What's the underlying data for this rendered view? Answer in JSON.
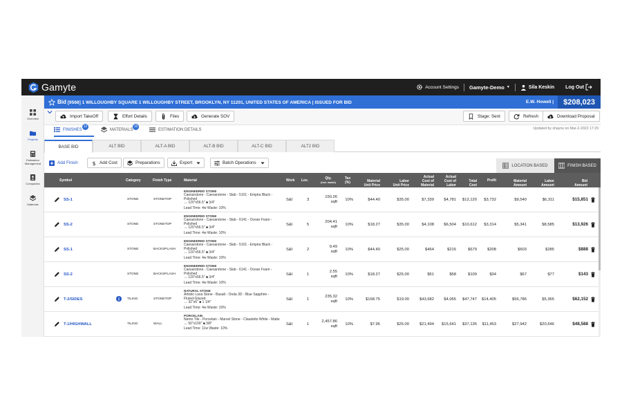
{
  "app": {
    "name": "Gamyte",
    "account_settings": "Account Settings",
    "org": "Gamyte-Demo",
    "user": "Sila Keskin",
    "logout": "Log Out"
  },
  "sidebar": {
    "items": [
      {
        "label": "Overview",
        "icon": "grid-icon"
      },
      {
        "label": "Projects",
        "icon": "folder-icon"
      },
      {
        "label": "Estimation Management",
        "icon": "calculator-icon"
      },
      {
        "label": "Companies",
        "icon": "contact-card-icon"
      },
      {
        "label": "Materials",
        "icon": "layers-icon"
      }
    ]
  },
  "bid": {
    "prefix": "Bid",
    "title": "[9568] 1 WILLOUGHBY SQUARE 1 WILLOUGHBY STREET, BROOKLYN, NY 11201, UNITED STATES OF AMERICA | ISSUED FOR BID",
    "client": "E.W. Howell |",
    "amount": "$208,023"
  },
  "toolbar": {
    "import": "Import TakeOff",
    "effort": "Effort Details",
    "files": "Files",
    "sov": "Generate SOV",
    "stage": "Stage: Sent",
    "refresh": "Refresh",
    "download": "Download Proposal"
  },
  "project_tabs": [
    {
      "label": "FINISHES",
      "badge": "12"
    },
    {
      "label": "MATERIALS",
      "badge": "16"
    },
    {
      "label": "ESTIMATION DETAILS"
    }
  ],
  "updated": "Updated by shayne on Mar-2-2022 17:29",
  "bid_tabs": [
    "BASE BID",
    "ALT BID",
    "ALT-A BID",
    "ALT-B BID",
    "ALT-C BID",
    "ALT2 BID"
  ],
  "ops": {
    "add_finish": "Add Finish",
    "add_cost": "Add Cost",
    "preparations": "Preparations",
    "export": "Export",
    "batch": "Batch Operations",
    "location_based": "LOCATION BASED",
    "finish_based": "FINISH BASED"
  },
  "columns": {
    "symbol": "Symbol",
    "category": "Category",
    "finish_type": "Finish Type",
    "material": "Material",
    "work": "Work",
    "loc": "Loc.",
    "qty": "Qty.",
    "qty_sub": "(incl. waste)",
    "tax": "Tax",
    "tax_sub": "(%)",
    "mat_unit": "Material",
    "mat_unit_sub": "Unit Price",
    "lab_unit": "Labor",
    "lab_unit_sub": "Unit Price",
    "act_mat": "Actual",
    "act_mat_sub": "Cost of",
    "act_mat_sub2": "Material",
    "act_lab": "Actual",
    "act_lab_sub": "Cost of",
    "act_lab_sub2": "Labor",
    "total": "Total",
    "total_sub": "Cost",
    "profit": "Profit",
    "mat_amt": "Material",
    "mat_amt_sub": "Amount",
    "lab_amt": "Labor",
    "lab_amt_sub": "Amount",
    "bid_amt": "Bid",
    "bid_amt_sub": "Amount"
  },
  "rows": [
    {
      "symbol": "SS-1",
      "category": "STONE",
      "finish_type": "STONETOP",
      "mat_name": "ENGINEERED STONE",
      "mat_desc": "Caesarstone - Caesarstone - Slab - 5101 - Empira Black - Polished",
      "mat_size": "↔ 120\"x56.5\" ■ 3/4\"",
      "lead": "Lead Time: 4w  Waste: 10%",
      "work": "S&I",
      "loc": "3",
      "qty": "150.26",
      "unit": "sqft",
      "tax": "10%",
      "mat_unit": "$44.40",
      "lab_unit": "$35.00",
      "act_mat": "$7,339",
      "act_lab": "$4,781",
      "total": "$12,120",
      "profit": "$3,732",
      "mat_amt": "$9,540",
      "lab_amt": "$6,311",
      "bid": "$15,851",
      "info": false
    },
    {
      "symbol": "SS-2",
      "category": "STONE",
      "finish_type": "STONETOP",
      "mat_name": "ENGINEERED STONE",
      "mat_desc": "Caesarstone - Caesarstone - Slab - 6141 - Ocean Foam - Polished",
      "mat_size": "↔ 120\"x56.5\" ■ 3/4\"",
      "lead": "Lead Time: 4w  Waste: 10%",
      "work": "S&I",
      "loc": "5",
      "qty": "204.41",
      "unit": "sqft",
      "tax": "10%",
      "mat_unit": "$18.27",
      "lab_unit": "$35.00",
      "act_mat": "$4,108",
      "act_lab": "$6,504",
      "total": "$10,612",
      "profit": "$3,314",
      "mat_amt": "$5,341",
      "lab_amt": "$8,585",
      "bid": "$13,926",
      "info": false
    },
    {
      "symbol": "SS-1",
      "category": "STONE",
      "finish_type": "BACKSPLASH",
      "mat_name": "ENGINEERED STONE",
      "mat_desc": "Caesarstone - Caesarstone - Slab - 5101 - Empira Black - Polished",
      "mat_size": "↔ 120\"x56.5\" ■ 3/4\"",
      "lead": "Lead Time: 4w  Waste: 10%",
      "work": "S&I",
      "loc": "2",
      "qty": "9.49",
      "unit": "sqft",
      "tax": "10%",
      "mat_unit": "$44.40",
      "lab_unit": "$25.00",
      "act_mat": "$464",
      "act_lab": "$216",
      "total": "$679",
      "profit": "$208",
      "mat_amt": "$603",
      "lab_amt": "$285",
      "bid": "$888",
      "info": false
    },
    {
      "symbol": "SS-2",
      "category": "STONE",
      "finish_type": "BACKSPLASH",
      "mat_name": "ENGINEERED STONE",
      "mat_desc": "Caesarstone - Caesarstone - Slab - 6141 - Ocean Foam - Polished",
      "mat_size": "↔ 120\"x56.5\" ■ 3/4\"",
      "lead": "Lead Time: 4w  Waste: 10%",
      "work": "S&I",
      "loc": "1",
      "qty": "2.55",
      "unit": "sqft",
      "tax": "10%",
      "mat_unit": "$18.27",
      "lab_unit": "$25.00",
      "act_mat": "$51",
      "act_lab": "$58",
      "total": "$109",
      "profit": "$34",
      "mat_amt": "$67",
      "lab_amt": "$77",
      "bid": "$143",
      "info": false
    },
    {
      "symbol": "T-2/SIDES",
      "category": "TILING",
      "finish_type": "STONETOP",
      "mat_name": "NATURAL STONE",
      "mat_desc": "Artistic Lava Stone - Basalt - Onda 3D - Blue Sapphire - Fluted-Glazed",
      "mat_size": "↔ 32\"x6\" ■ 1 1/4\"",
      "lead": "Lead Time: 4w  Waste: 10%",
      "work": "S&I",
      "loc": "1",
      "qty": "235.32",
      "unit": "sqft",
      "tax": "10%",
      "mat_unit": "$168.75",
      "lab_unit": "$19.00",
      "act_mat": "$43,682",
      "act_lab": "$4,065",
      "total": "$47,747",
      "profit": "$14,405",
      "mat_amt": "$56,786",
      "lab_amt": "$5,365",
      "bid": "$62,152",
      "info": true
    },
    {
      "symbol": "T-1/HIGHWALL",
      "category": "TILING",
      "finish_type": "WALL",
      "mat_name": "PORCELAIN",
      "mat_desc": "Nemo Tile - Porcelain - Marvel Stone - Claudetto White - Matte",
      "mat_size": "↔ 50\"x100\" ■ 3/8\"",
      "lead": "Lead Time: 11w  Waste: 10%",
      "work": "S&I",
      "loc": "1",
      "qty": "2,457.86",
      "unit": "sqft",
      "tax": "10%",
      "mat_unit": "$7.95",
      "lab_unit": "$25.00",
      "act_mat": "$21,494",
      "act_lab": "$15,641",
      "total": "$37,135",
      "profit": "$11,453",
      "mat_amt": "$27,942",
      "lab_amt": "$20,646",
      "bid": "$48,588",
      "info": false
    }
  ]
}
